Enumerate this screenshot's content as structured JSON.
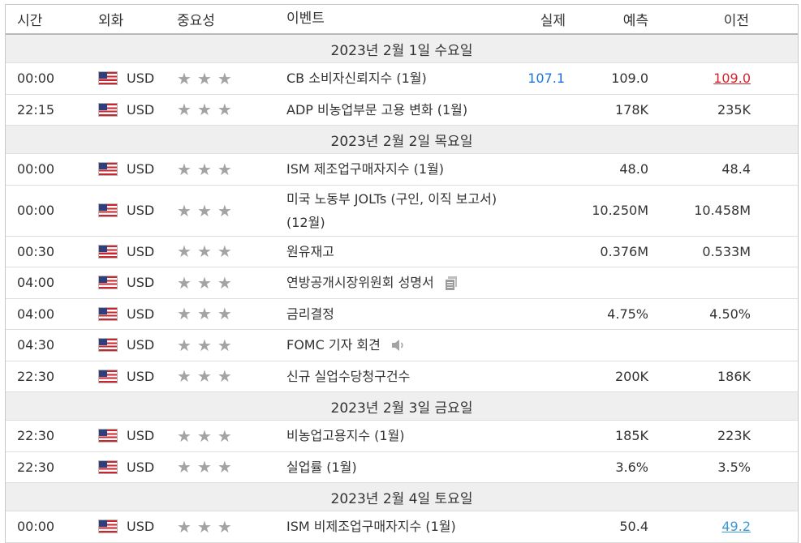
{
  "header": {
    "time": "시간",
    "currency": "외화",
    "importance": "중요성",
    "event": "이벤트",
    "actual": "실제",
    "forecast": "예측",
    "previous": "이전"
  },
  "stars": "★",
  "days": [
    {
      "label": "2023년 2월 1일 수요일"
    },
    {
      "label": "2023년 2월 2일 목요일"
    },
    {
      "label": "2023년 2월 3일 금요일"
    },
    {
      "label": "2023년 2월 4일 토요일"
    }
  ],
  "events": [
    {
      "time": "00:00",
      "currency": "USD",
      "event": "CB 소비자신뢰지수 (1월)",
      "actual": "107.1",
      "forecast": "109.0",
      "previous": "109.0",
      "actual_color": "#1a73d8",
      "previous_color": "#d4242c"
    },
    {
      "time": "22:15",
      "currency": "USD",
      "event": "ADP 비농업부문 고용 변화 (1월)",
      "actual": "",
      "forecast": "178K",
      "previous": "235K"
    },
    {
      "time": "00:00",
      "currency": "USD",
      "event": "ISM 제조업구매자지수 (1월)",
      "actual": "",
      "forecast": "48.0",
      "previous": "48.4"
    },
    {
      "time": "00:00",
      "currency": "USD",
      "event": "미국 노동부 JOLTs (구인, 이직 보고서) (12월)",
      "actual": "",
      "forecast": "10.250M",
      "previous": "10.458M"
    },
    {
      "time": "00:30",
      "currency": "USD",
      "event": "원유재고",
      "actual": "",
      "forecast": "0.376M",
      "previous": "0.533M"
    },
    {
      "time": "04:00",
      "currency": "USD",
      "event": "연방공개시장위원회 성명서",
      "actual": "",
      "forecast": "",
      "previous": "",
      "icon": "document-icon"
    },
    {
      "time": "04:00",
      "currency": "USD",
      "event": "금리결정",
      "actual": "",
      "forecast": "4.75%",
      "previous": "4.50%"
    },
    {
      "time": "04:30",
      "currency": "USD",
      "event": "FOMC 기자 회견",
      "actual": "",
      "forecast": "",
      "previous": "",
      "icon": "speaker-icon"
    },
    {
      "time": "22:30",
      "currency": "USD",
      "event": "신규 실업수당청구건수",
      "actual": "",
      "forecast": "200K",
      "previous": "186K"
    },
    {
      "time": "22:30",
      "currency": "USD",
      "event": "비농업고용지수 (1월)",
      "actual": "",
      "forecast": "185K",
      "previous": "223K"
    },
    {
      "time": "22:30",
      "currency": "USD",
      "event": "실업률 (1월)",
      "actual": "",
      "forecast": "3.6%",
      "previous": "3.5%"
    },
    {
      "time": "00:00",
      "currency": "USD",
      "event": "ISM 비제조업구매자지수 (1월)",
      "actual": "",
      "forecast": "50.4",
      "previous": "49.2",
      "previous_color": "#3a9ad8"
    }
  ]
}
